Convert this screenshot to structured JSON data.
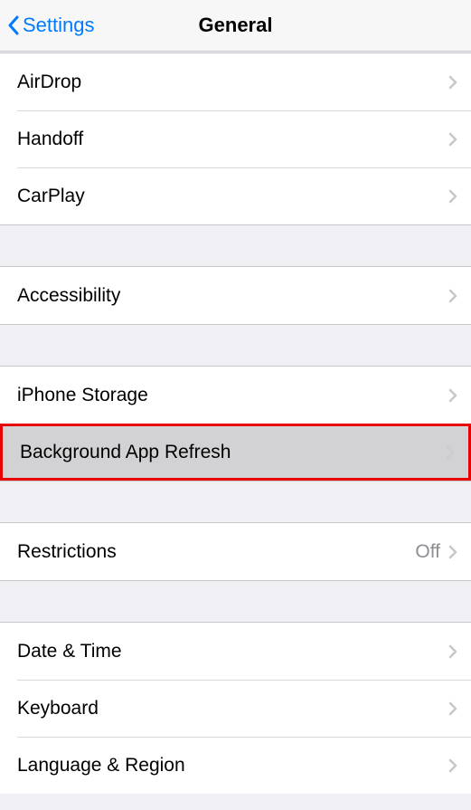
{
  "nav": {
    "back_label": "Settings",
    "title": "General"
  },
  "sections": [
    {
      "items": [
        {
          "label": "AirDrop"
        },
        {
          "label": "Handoff"
        },
        {
          "label": "CarPlay"
        }
      ]
    },
    {
      "items": [
        {
          "label": "Accessibility"
        }
      ]
    },
    {
      "items": [
        {
          "label": "iPhone Storage"
        },
        {
          "label": "Background App Refresh",
          "highlighted": true
        }
      ]
    },
    {
      "items": [
        {
          "label": "Restrictions",
          "detail": "Off"
        }
      ]
    },
    {
      "items": [
        {
          "label": "Date & Time"
        },
        {
          "label": "Keyboard"
        },
        {
          "label": "Language & Region"
        }
      ]
    }
  ]
}
